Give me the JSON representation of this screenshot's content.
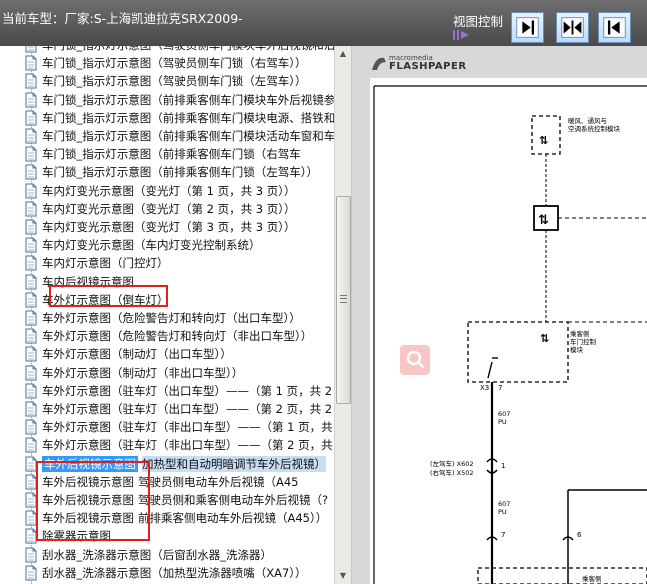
{
  "topbar": {
    "title": "当前车型：厂家:S-上海凯迪拉克SRX2009-",
    "view_control_label": "视图控制"
  },
  "tree": {
    "items": [
      {
        "text": "车门锁_指示灯示意图（驾驶员侧车门模块车外后视镜和泊"
      },
      {
        "text": "车门锁_指示灯示意图（驾驶员侧车门锁（右驾车））"
      },
      {
        "text": "车门锁_指示灯示意图（驾驶员侧车门锁（左驾车））"
      },
      {
        "text": "车门锁_指示灯示意图（前排乘客侧车门模块车外后视镜参"
      },
      {
        "text": "车门锁_指示灯示意图（前排乘客侧车门模块电源、搭铁和"
      },
      {
        "text": "车门锁_指示灯示意图（前排乘客侧车门模块活动车窗和车"
      },
      {
        "text": "车门锁_指示灯示意图（前排乘客侧车门锁（右驾车"
      },
      {
        "text": "车门锁_指示灯示意图（前排乘客侧车门锁（左驾车））"
      },
      {
        "text": "车内灯变光示意图（变光灯（第 1 页，共 3 页））"
      },
      {
        "text": "车内灯变光示意图（变光灯（第 2 页，共 3 页））"
      },
      {
        "text": "车内灯变光示意图（变光灯（第 3 页，共 3 页））"
      },
      {
        "text": "车内灯变光示意图（车内灯变光控制系统）"
      },
      {
        "text": "车内灯示意图（门控灯）"
      },
      {
        "text": "车内后视镜示意图"
      },
      {
        "text": "车外灯示意图（倒车灯）"
      },
      {
        "text": "车外灯示意图（危险警告灯和转向灯（出口车型））"
      },
      {
        "text": "车外灯示意图（危险警告灯和转向灯（非出口车型））"
      },
      {
        "text": "车外灯示意图（制动灯（出口车型））"
      },
      {
        "text": "车外灯示意图（制动灯（非出口车型））"
      },
      {
        "text": "车外灯示意图（驻车灯（出口车型）——（第 1 页，共 2"
      },
      {
        "text": "车外灯示意图（驻车灯（出口车型）——（第 2 页，共 2"
      },
      {
        "text": "车外灯示意图（驻车灯（非出口车型）——（第 1 页，共"
      },
      {
        "text": "车外灯示意图（驻车灯（非出口车型）——（第 2 页，共"
      },
      {
        "label": "车外后视镜示意图",
        "tail": "加热型和自动明暗调节车外后视镜）"
      },
      {
        "label": "车外后视镜示意图",
        "tail": "驾驶员侧电动车外后视镜（A45"
      },
      {
        "label": "车外后视镜示意图",
        "tail": "驾驶员侧和乘客侧电动车外后视镜（?"
      },
      {
        "label": "车外后视镜示意图",
        "tail": "前排乘客侧电动车外后视镜（A45））"
      },
      {
        "text": "除雾器示意图"
      },
      {
        "text": "刮水器_洗涤器示意图（后窗刮水器_洗涤器）"
      },
      {
        "text": "刮水器_洗涤器示意图（加热型洗涤器喷嘴（XA7））"
      }
    ]
  },
  "viewer": {
    "logo_small": "macromedia",
    "logo_big": "FLASHPAPER",
    "diagram": {
      "module_top_line1": "暖风、通风与",
      "module_top_line2": "空调系统控制模块",
      "module_mid_line1": "乘客侧",
      "module_mid_line2": "车门控制",
      "module_mid_line3": "模块",
      "pin_x3": "X3",
      "pin_7": "7",
      "wire_607a": "607",
      "wire_pu_a": "PU",
      "conn_left_line1": "(左驾车) X602",
      "conn_left_line2": "(右驾车) X502",
      "pin_1": "1",
      "wire_607b": "607",
      "wire_pu_b": "PU",
      "pin_7b": "7",
      "pin_6": "6",
      "module_bottom": "乘客侧"
    }
  },
  "colors": {
    "topbar": "#5a5a5a",
    "highlight": "#e02020",
    "selection": "#3399ff"
  }
}
